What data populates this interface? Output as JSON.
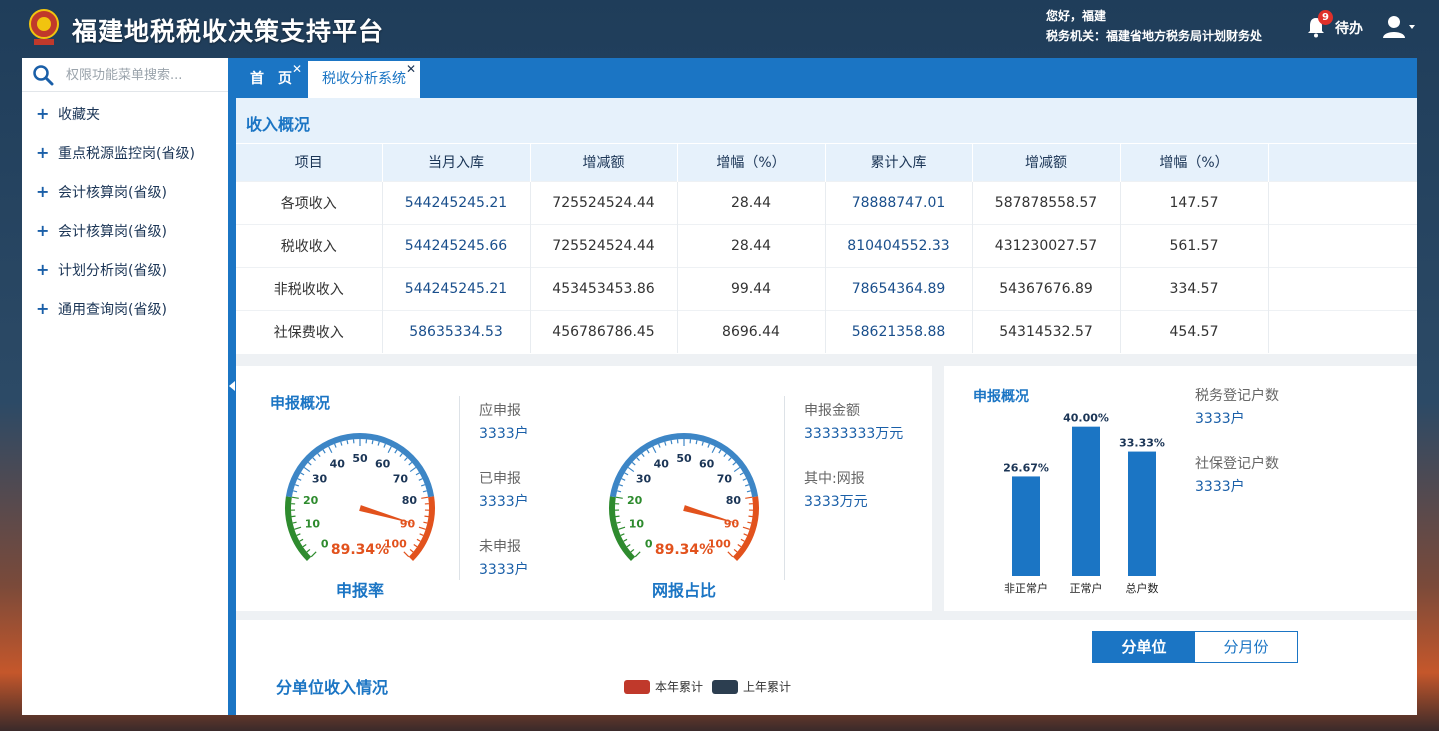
{
  "header": {
    "title": "福建地税税收决策支持平台",
    "greeting": "您好，福建",
    "org": "税务机关：福建省地方税务局计划财务处",
    "notification_count": "9",
    "todo_label": "待办"
  },
  "sidebar": {
    "search_placeholder": "权限功能菜单搜索...",
    "items": [
      {
        "label": "收藏夹"
      },
      {
        "label": "重点税源监控岗(省级)"
      },
      {
        "label": "会计核算岗(省级)"
      },
      {
        "label": "会计核算岗(省级)"
      },
      {
        "label": "计划分析岗(省级)"
      },
      {
        "label": "通用查询岗(省级)"
      }
    ]
  },
  "tabs": [
    {
      "label": "首　页"
    },
    {
      "label": "税收分析系统"
    }
  ],
  "income": {
    "title": "收入概况",
    "headers": [
      "项目",
      "当月入库",
      "增减额",
      "增幅（%）",
      "累计入库",
      "增减额",
      "增幅（%）"
    ],
    "rows": [
      [
        "各项收入",
        "544245245.21",
        "725524524.44",
        "28.44",
        "78888747.01",
        "587878558.57",
        "147.57"
      ],
      [
        "税收收入",
        "544245245.66",
        "725524524.44",
        "28.44",
        "810404552.33",
        "431230027.57",
        "561.57"
      ],
      [
        "非税收收入",
        "544245245.21",
        "453453453.86",
        "99.44",
        "78654364.89",
        "54367676.89",
        "334.57"
      ],
      [
        "社保费收入",
        "58635334.53",
        "456786786.45",
        "8696.44",
        "58621358.88",
        "54314532.57",
        "454.57"
      ]
    ]
  },
  "report": {
    "title": "申报概况",
    "gauge1": {
      "label": "申报率",
      "value_text": "89.34%",
      "value": 89.34
    },
    "gauge2": {
      "label": "网报占比",
      "value_text": "89.34%",
      "value": 89.34
    },
    "ticks": [
      "0",
      "10",
      "20",
      "30",
      "40",
      "50",
      "60",
      "70",
      "80",
      "90",
      "100"
    ],
    "stats_a": [
      {
        "label": "应申报",
        "value": "3333户"
      },
      {
        "label": "已申报",
        "value": "3333户"
      },
      {
        "label": "未申报",
        "value": "3333户"
      }
    ],
    "stats_b": [
      {
        "label": "申报金额",
        "value": "33333333万元"
      },
      {
        "label": "其中:网报",
        "value": "3333万元"
      }
    ]
  },
  "register": {
    "title": "申报概况",
    "chart_data": {
      "type": "bar",
      "categories": [
        "非正常户",
        "正常户",
        "总户数"
      ],
      "values": [
        26.67,
        40.0,
        33.33
      ],
      "data_labels": [
        "26.67%",
        "40.00%",
        "33.33%"
      ],
      "ylim": [
        0,
        45
      ],
      "grid": false,
      "color": "#1b75c4"
    },
    "stats": [
      {
        "label": "税务登记户数",
        "value": "3333户"
      },
      {
        "label": "社保登记户数",
        "value": "3333户"
      }
    ]
  },
  "unit": {
    "title": "分单位收入情况",
    "toggle_on": "分单位",
    "toggle_off": "分月份",
    "legend": [
      {
        "label": "本年累计",
        "color": "#c0392b"
      },
      {
        "label": "上年累计",
        "color": "#2c3e50"
      }
    ]
  }
}
